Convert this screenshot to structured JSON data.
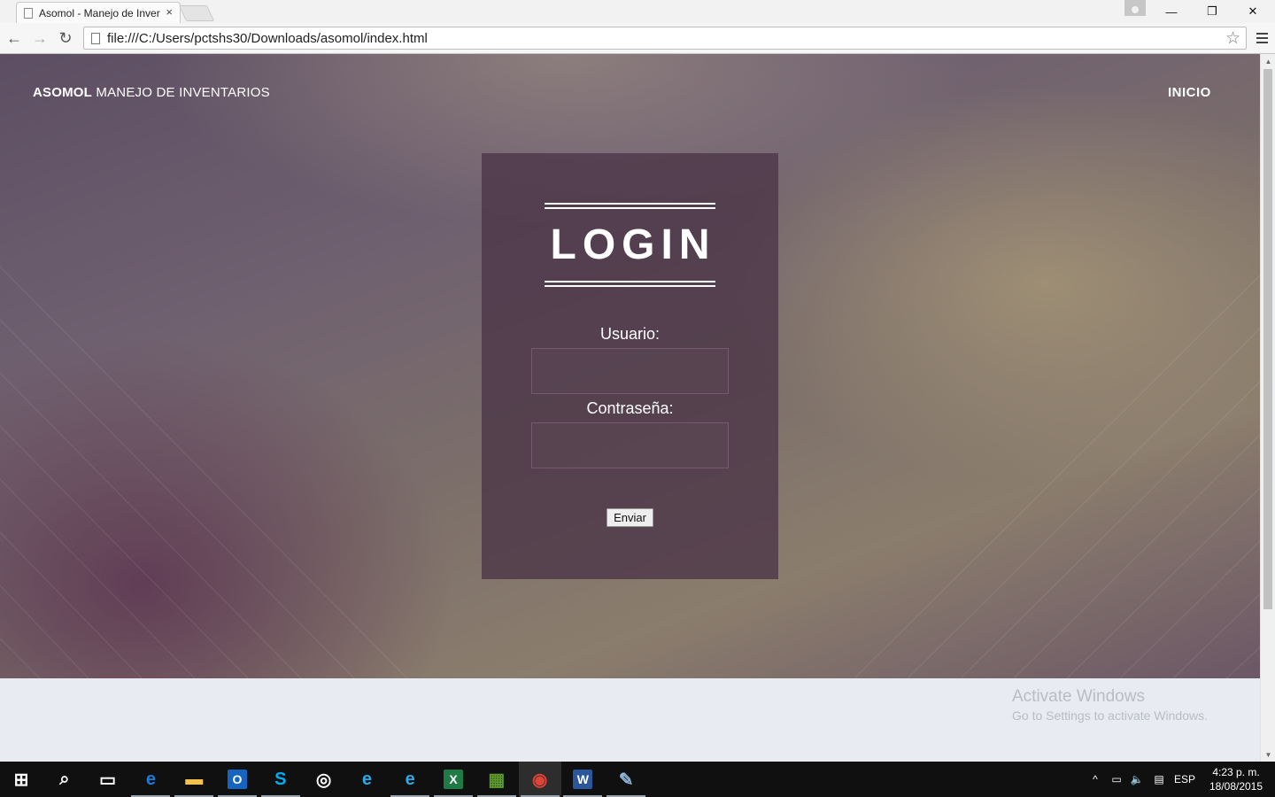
{
  "browser": {
    "tab_title": "Asomol - Manejo de Inver",
    "tab_close": "×",
    "url": "file:///C:/Users/pctshs30/Downloads/asomol/index.html",
    "back_glyph": "←",
    "forward_glyph": "→",
    "reload_glyph": "↻",
    "star_glyph": "☆",
    "minimize_glyph": "—",
    "maximize_glyph": "❐",
    "close_glyph": "✕"
  },
  "site": {
    "brand_bold": "ASOMOL",
    "brand_rest": " MANEJO DE INVENTARIOS",
    "nav_inicio": "INICIO"
  },
  "login": {
    "title": "LOGIN",
    "usuario_label": "Usuario:",
    "contrasena_label": "Contraseña:",
    "usuario_value": "",
    "contrasena_value": "",
    "submit_label": "Enviar"
  },
  "watermark": {
    "line1": "Activate Windows",
    "line2": "Go to Settings to activate Windows."
  },
  "taskbar": {
    "apps": [
      {
        "name": "start-icon",
        "glyph": "⊞",
        "color": "#ffffff"
      },
      {
        "name": "search-icon",
        "glyph": "⌕",
        "color": "#ffffff"
      },
      {
        "name": "task-view-icon",
        "glyph": "▭",
        "color": "#ffffff"
      },
      {
        "name": "edge-icon",
        "glyph": "e",
        "color": "#1e7ad8"
      },
      {
        "name": "file-explorer-icon",
        "glyph": "▬",
        "color": "#f2c14e"
      },
      {
        "name": "outlook-icon",
        "glyph": "O",
        "color": "#1565c0"
      },
      {
        "name": "skype-icon",
        "glyph": "S",
        "color": "#00aff0"
      },
      {
        "name": "groove-music-icon",
        "glyph": "◎",
        "color": "#ffffff"
      },
      {
        "name": "internet-explorer-icon",
        "glyph": "e",
        "color": "#2aa9e8"
      },
      {
        "name": "internet-explorer-2-icon",
        "glyph": "e",
        "color": "#2aa9e8"
      },
      {
        "name": "excel-icon",
        "glyph": "X",
        "color": "#1f7a45"
      },
      {
        "name": "project-icon",
        "glyph": "▦",
        "color": "#5c9a2c"
      },
      {
        "name": "chrome-icon",
        "glyph": "◉",
        "color": "#dc4437"
      },
      {
        "name": "word-icon",
        "glyph": "W",
        "color": "#2b579a"
      },
      {
        "name": "paint-icon",
        "glyph": "✎",
        "color": "#8fb4d8"
      }
    ],
    "tray_chevron": "^",
    "tray_network": "▭",
    "tray_volume": "🔈",
    "tray_notifications": "▤",
    "language": "ESP",
    "time": "4:23 p. m.",
    "date": "18/08/2015"
  }
}
